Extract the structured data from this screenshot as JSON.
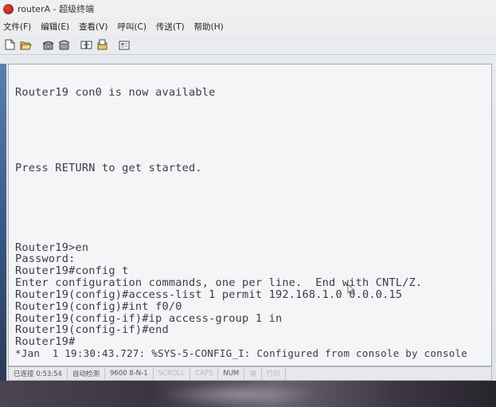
{
  "window": {
    "title": "routerA - 超级终端"
  },
  "menu": {
    "items": [
      "文件(F)",
      "编辑(E)",
      "查看(V)",
      "呼叫(C)",
      "传送(T)",
      "帮助(H)"
    ]
  },
  "toolbar": {
    "icons": [
      "new-icon",
      "open-icon",
      "phone-icon",
      "disconnect-icon",
      "send-icon",
      "receive-icon",
      "properties-icon"
    ]
  },
  "terminal": {
    "lines": [
      "Router19 con0 is now available",
      "Press RETURN to get started.",
      "Router19>en",
      "Password:",
      "Router19#config t",
      "Enter configuration commands, one per line.  End with CNTL/Z.",
      "Router19(config)#access-list 1 permit 192.168.1.0 0.0.0.15",
      "Router19(config)#int f0/0",
      "Router19(config-if)#ip access-group 1 in",
      "Router19(config-if)#end",
      "Router19#",
      "*Jan  1 19:30:43.727: %SYS-5-CONFIG_I: Configured from console by console"
    ]
  },
  "status": {
    "connected": "已连接 0:53:54",
    "detect": "自动检测",
    "settings": "9600 8-N-1",
    "scroll": "SCROLL",
    "caps": "CAPS",
    "num": "NUM",
    "capture": "捕",
    "print": "打印"
  }
}
